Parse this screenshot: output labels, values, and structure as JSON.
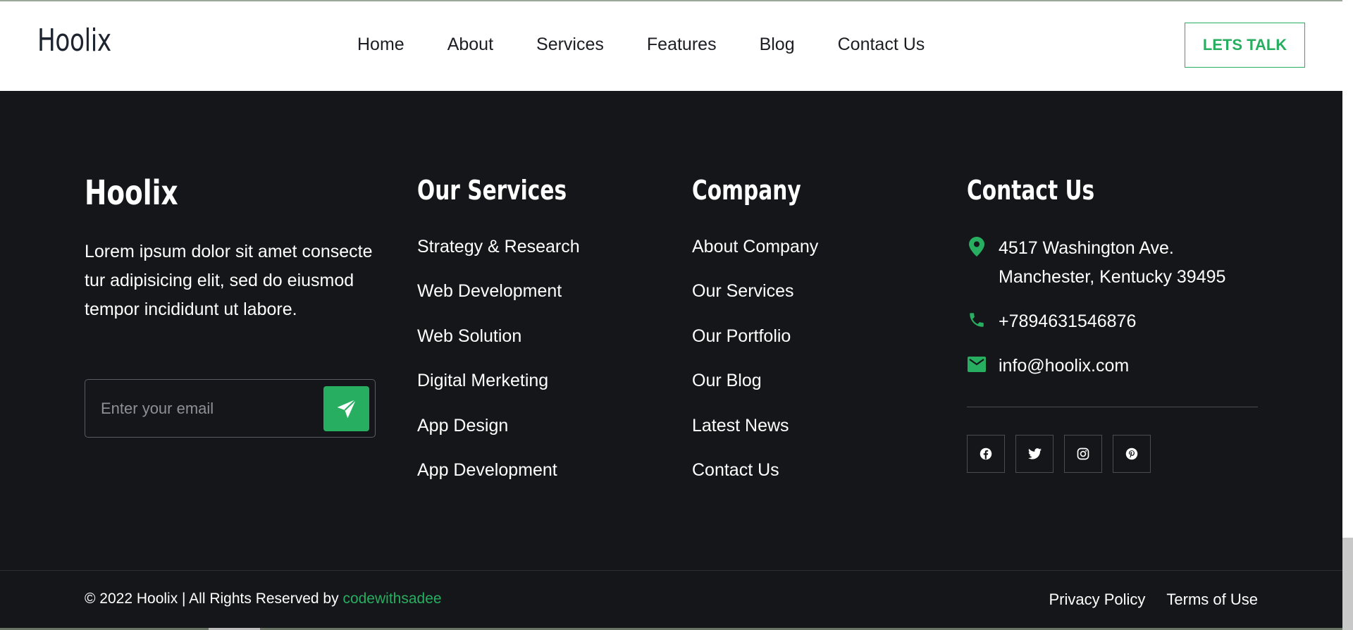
{
  "header": {
    "brand": "Hoolix",
    "nav": [
      "Home",
      "About",
      "Services",
      "Features",
      "Blog",
      "Contact Us"
    ],
    "cta_label": "LETS TALK"
  },
  "footer": {
    "brand": "Hoolix",
    "about_text": "Lorem ipsum dolor sit amet consecte tur adipisicing elit, sed do eiusmod tempor incididunt ut labore.",
    "email_placeholder": "Enter your email",
    "services_title": "Our Services",
    "services": [
      "Strategy & Research",
      "Web Development",
      "Web Solution",
      "Digital Merketing",
      "App Design",
      "App Development"
    ],
    "company_title": "Company",
    "company": [
      "About Company",
      "Our Services",
      "Our Portfolio",
      "Our Blog",
      "Latest News",
      "Contact Us"
    ],
    "contact_title": "Contact Us",
    "contact": {
      "address_line1": "4517 Washington Ave.",
      "address_line2": "Manchester, Kentucky 39495",
      "phone": "+7894631546876",
      "email": "info@hoolix.com"
    },
    "socials": [
      "facebook-icon",
      "twitter-icon",
      "instagram-icon",
      "pinterest-icon"
    ],
    "copyright_prefix": "© 2022 Hoolix | All Rights Reserved by",
    "credit": "codewithsadee",
    "legal": [
      "Privacy Policy",
      "Terms of Use"
    ]
  },
  "colors": {
    "accent": "#27ae60",
    "footer_bg": "#15161a",
    "header_bg": "#ffffff"
  }
}
